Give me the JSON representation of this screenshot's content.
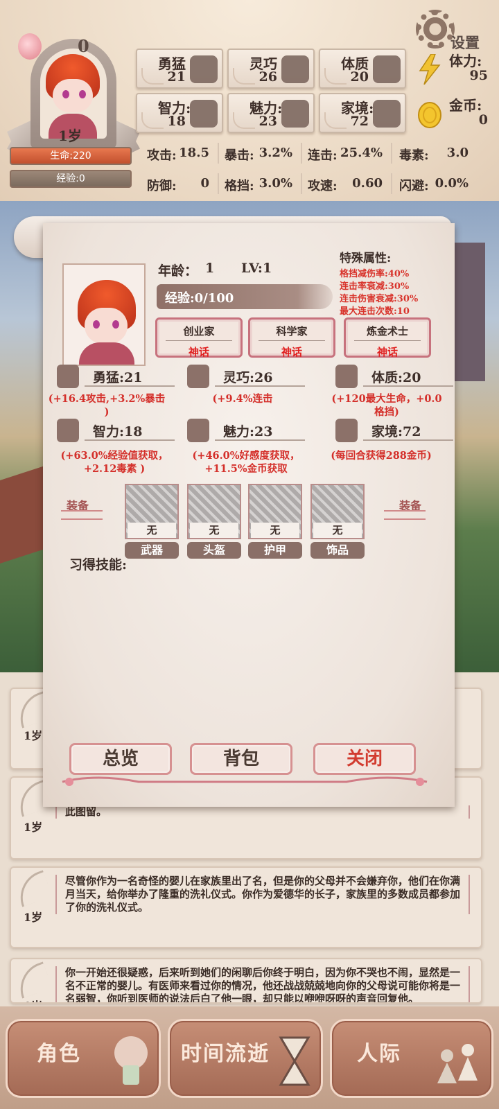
{
  "header": {
    "settings_label": "设置",
    "top_level": "0",
    "age": "1岁",
    "hp_label": "生命:220",
    "xp_label": "经验:0"
  },
  "attributes": [
    {
      "name": "勇猛",
      "value": "21",
      "icon": "fist-icon"
    },
    {
      "name": "灵巧",
      "value": "26",
      "icon": "cloak-icon"
    },
    {
      "name": "体质",
      "value": "20",
      "icon": "arm-icon"
    },
    {
      "name": "智力:",
      "value": "18",
      "icon": "brain-icon"
    },
    {
      "name": "魅力:",
      "value": "23",
      "icon": "flower-icon"
    },
    {
      "name": "家境:",
      "value": "72",
      "icon": "hand-coin-icon"
    }
  ],
  "resources": [
    {
      "name": "体力:",
      "value": "95",
      "icon": "lightning-icon"
    },
    {
      "name": "金币:",
      "value": "0",
      "icon": "gold-coin-icon"
    }
  ],
  "combat_stats": [
    {
      "key": "攻击:",
      "value": "18.5"
    },
    {
      "key": "暴击:",
      "value": "3.2%"
    },
    {
      "key": "连击:",
      "value": "25.4%"
    },
    {
      "key": "毒素:",
      "value": "3.0"
    },
    {
      "key": "防御:",
      "value": "0"
    },
    {
      "key": "格挡:",
      "value": "3.0%"
    },
    {
      "key": "攻速:",
      "value": "0.60"
    },
    {
      "key": "闪避:",
      "value": "0.0%"
    }
  ],
  "panel": {
    "age_label": "年龄：",
    "age_value": "1",
    "level": "LV:1",
    "exp": "经验:0/100",
    "special_title": "特殊属性:",
    "special": [
      "格挡减伤率:40%",
      "连击率衰减:30%",
      "连击伤害衰减:30%",
      "最大连击次数:10"
    ],
    "traits": [
      {
        "name": "创业家",
        "rarity": "神话"
      },
      {
        "name": "科学家",
        "rarity": "神话"
      },
      {
        "name": "炼金术士",
        "rarity": "神话"
      }
    ],
    "attrs": [
      {
        "label": "勇猛:21",
        "bonus": "(+16.4攻击,+3.2%暴击 )"
      },
      {
        "label": "灵巧:26",
        "bonus": "(+9.4%连击"
      },
      {
        "label": "体质:20",
        "bonus": "(+120最大生命，+0.0格挡)"
      },
      {
        "label": "智力:18",
        "bonus": "(+63.0%经验值获取，+2.12毒素 )"
      },
      {
        "label": "魅力:23",
        "bonus": "(+46.0%好感度获取，+11.5%金币获取"
      },
      {
        "label": "家境:72",
        "bonus": "(每回合获得288金币)"
      }
    ],
    "equip_label": "装备",
    "slots": [
      {
        "name": "武器",
        "state": "无"
      },
      {
        "name": "头盔",
        "state": "无"
      },
      {
        "name": "护甲",
        "state": "无"
      },
      {
        "name": "饰品",
        "state": "无"
      }
    ],
    "skills_label": "习得技能:",
    "buttons": {
      "overview": "总览",
      "bag": "背包",
      "close": "关闭"
    }
  },
  "log": [
    {
      "age": "1岁",
      "text": ""
    },
    {
      "age": "1岁",
      "text": "此图留。"
    },
    {
      "age": "1岁",
      "text": "尽管你作为一名奇怪的婴儿在家族里出了名，但是你的父母并不会嫌弃你，他们在你满月当天，给你举办了隆重的洗礼仪式。你作为爱德华的长子，家族里的多数成员都参加了你的洗礼仪式。"
    },
    {
      "age": "1岁",
      "text": "你一开始还很疑惑，后来听到她们的闲聊后你终于明白，因为你不哭也不闹，显然是一名不正常的婴儿。有医师来看过你的情况，他还战战兢兢地向你的父母说可能你将是一名弱智，你听到医师的说法后白了他一眼，却只能以咿咿呀呀的声音回复他。"
    }
  ],
  "nav": [
    {
      "label": "角色",
      "icon": "character-icon"
    },
    {
      "label": "时间流逝",
      "icon": "hourglass-icon"
    },
    {
      "label": "人际",
      "icon": "people-icon"
    }
  ],
  "colors": {
    "accent_red": "#d8332b",
    "hp_bar": "#d8663c",
    "panel_bg": "#f2e9e2",
    "nav_bg": "#b97e68"
  }
}
